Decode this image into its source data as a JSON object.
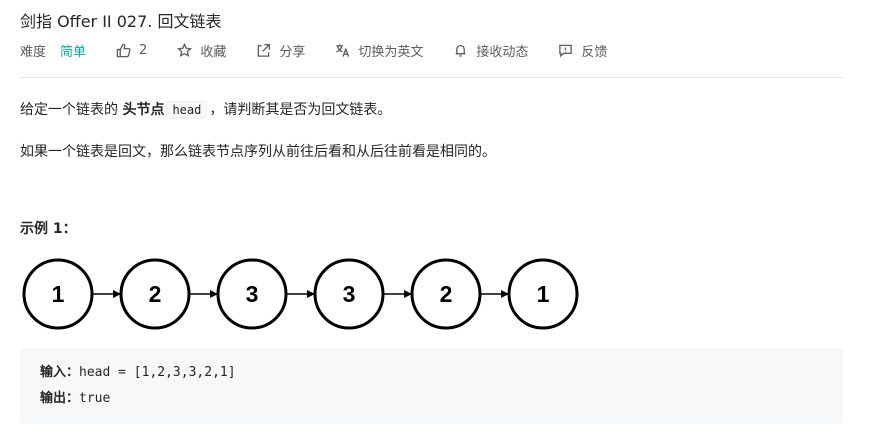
{
  "problem": {
    "title": "剑指 Offer II 027. 回文链表"
  },
  "toolbar": {
    "difficulty_label": "难度",
    "difficulty_value": "简单",
    "likes": "2",
    "collect": "收藏",
    "share": "分享",
    "translate": "切换为英文",
    "subscribe": "接收动态",
    "feedback": "反馈",
    "colors": {
      "difficulty": "#00af9b"
    },
    "icons": [
      "thumbs-up-icon",
      "star-icon",
      "share-icon",
      "translate-icon",
      "bell-icon",
      "feedback-icon"
    ]
  },
  "description": {
    "p1_before": "给定一个链表的 ",
    "p1_bold": "头节点",
    "p1_code": "head",
    "p1_after": "，请判断其是否为回文链表。",
    "p2": "如果一个链表是回文，那么链表节点序列从前往后看和从后往前看是相同的。"
  },
  "example": {
    "title": "示例 1：",
    "nodes": [
      "1",
      "2",
      "3",
      "3",
      "2",
      "1"
    ],
    "input_label": "输入：",
    "input_value": "head = [1,2,3,3,2,1]",
    "output_label": "输出：",
    "output_value": "true"
  }
}
